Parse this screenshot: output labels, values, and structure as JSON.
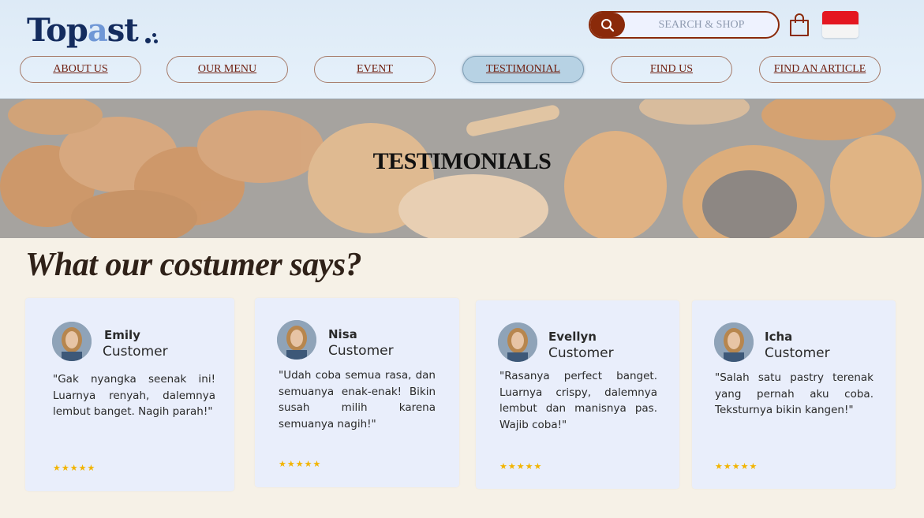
{
  "brand": {
    "logo_main": "Top",
    "logo_accent": "a",
    "logo_end": "st"
  },
  "search": {
    "placeholder": "SEARCH & SHOP"
  },
  "nav": [
    {
      "label": "ABOUT US",
      "active": false
    },
    {
      "label": "OUR MENU",
      "active": false
    },
    {
      "label": "EVENT",
      "active": false
    },
    {
      "label": "TESTIMONIAL",
      "active": true
    },
    {
      "label": "FIND US",
      "active": false
    },
    {
      "label": "FIND AN ARTICLE",
      "active": false
    }
  ],
  "hero": {
    "title": "TESTIMONIALS"
  },
  "section": {
    "title": "What our costumer says?"
  },
  "testimonials": [
    {
      "name": "Emily",
      "role": "Customer",
      "text": "\"Gak nyangka seenak ini! Luarnya renyah, dalemnya lembut banget. Nagih parah!\"",
      "rating": 5,
      "stars": "★★★★★"
    },
    {
      "name": "Nisa",
      "role": "Customer",
      "text": "\"Udah coba semua rasa, dan semuanya enak-enak! Bikin susah milih karena semuanya nagih!\"",
      "rating": 5,
      "stars": "★★★★★"
    },
    {
      "name": "Evellyn",
      "role": "Customer",
      "text": "\"Rasanya perfect banget. Luarnya crispy, dalemnya lembut dan manisnya pas. Wajib coba!\"",
      "rating": 5,
      "stars": "★★★★★"
    },
    {
      "name": "Icha",
      "role": "Customer",
      "text": "\"Salah satu pastry terenak yang pernah aku coba. Teksturnya bikin kangen!\"",
      "rating": 5,
      "stars": "★★★★★"
    }
  ],
  "colors": {
    "brand_navy": "#142c5e",
    "brand_accent": "#6f97d6",
    "nav_text": "#6e1c0c",
    "search_button": "#8a2a0a",
    "active_nav": "#b7d2e4",
    "card_bg": "#e9eefb",
    "star": "#f2b400",
    "flag_red": "#e4161f"
  },
  "icons": {
    "search": "search-icon",
    "cart": "shopping-bag-icon",
    "flag": "indonesia-flag-icon"
  }
}
